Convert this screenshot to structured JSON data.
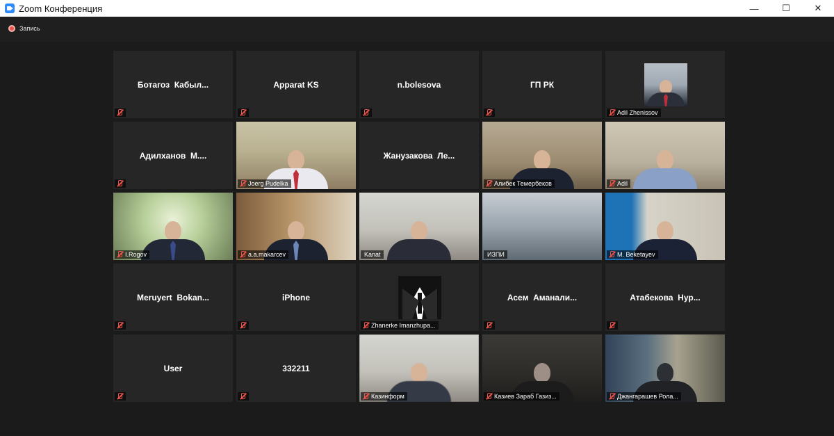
{
  "window": {
    "title": "Zoom Конференция",
    "controls": {
      "minimize": "—",
      "maximize": "☐",
      "close": "✕"
    }
  },
  "recording": {
    "label": "Запись"
  },
  "participants": [
    {
      "name": "Ботагоз  Кабыл...",
      "video": false
    },
    {
      "name": "Apparat KS",
      "video": false
    },
    {
      "name": "n.bolesova",
      "video": false
    },
    {
      "name": "ГП РК",
      "video": false
    },
    {
      "name": "Adil Zhenissov",
      "video": false,
      "avatar": "photo"
    },
    {
      "name": "Адилханов  М....",
      "video": false
    },
    {
      "name": "Joerg Pudelka",
      "video": true
    },
    {
      "name": "Жанузакова  Ле...",
      "video": false
    },
    {
      "name": "Алибек Темербеков",
      "video": true
    },
    {
      "name": "Adil",
      "video": true
    },
    {
      "name": "I.Rogov",
      "video": true
    },
    {
      "name": "a.a.makarcev",
      "video": true
    },
    {
      "name": "Kanat",
      "video": true,
      "active": true
    },
    {
      "name": "ИЗПИ",
      "video": true
    },
    {
      "name": "M. Beketayev",
      "video": true
    },
    {
      "name": "Meruyert  Bokan...",
      "video": false
    },
    {
      "name": "iPhone",
      "video": false
    },
    {
      "name": "Zhanerke Imanzhupa...",
      "video": false,
      "avatar": "tuxedo"
    },
    {
      "name": "Асем  Аманали...",
      "video": false
    },
    {
      "name": "Атабекова  Нур...",
      "video": false
    },
    {
      "name": "User",
      "video": false
    },
    {
      "name": "332211",
      "video": false
    },
    {
      "name": "Казинформ",
      "video": true
    },
    {
      "name": "Казиев Зараб Газиз...",
      "video": true
    },
    {
      "name": "Джангарашев Рола...",
      "video": true
    }
  ]
}
